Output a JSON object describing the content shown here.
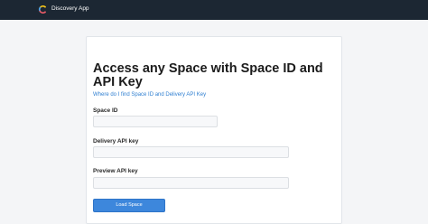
{
  "header": {
    "app_title": "Discovery App",
    "logo_icon": "contentful-logo-icon",
    "background_color": "#1c2733"
  },
  "form": {
    "heading": "Access any Space with Space ID and API Key",
    "help_link": "Where do I find Space ID and Delivery API Key",
    "space_id": {
      "label": "Space ID",
      "value": "",
      "placeholder": ""
    },
    "delivery_api_key": {
      "label": "Delivery API key",
      "value": "",
      "placeholder": ""
    },
    "preview_api_key": {
      "label": "Preview API key",
      "value": "",
      "placeholder": ""
    },
    "submit_label": "Load Space",
    "accent_color": "#3d87dc"
  }
}
